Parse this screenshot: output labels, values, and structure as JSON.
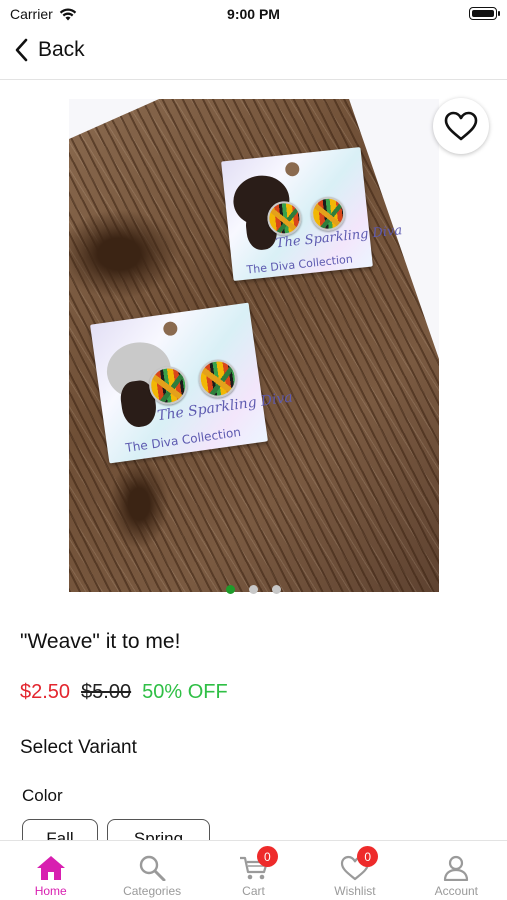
{
  "status_bar": {
    "carrier": "Carrier",
    "time": "9:00 PM"
  },
  "nav": {
    "back_label": "Back"
  },
  "product": {
    "image_card_script": "The Sparkling Diva",
    "image_card_collection": "The Diva Collection",
    "title": "\"Weave\" it to me!",
    "sale_price": "$2.50",
    "original_price": "$5.00",
    "discount": "50% OFF",
    "image_count": 3,
    "active_image": 0
  },
  "variants": {
    "heading": "Select Variant",
    "option_name": "Color",
    "options": [
      "Fall",
      "Spring"
    ]
  },
  "tab_bar": {
    "tabs": [
      {
        "label": "Home",
        "icon": "home-icon",
        "active": true
      },
      {
        "label": "Categories",
        "icon": "search-icon"
      },
      {
        "label": "Cart",
        "icon": "cart-icon",
        "badge": "0"
      },
      {
        "label": "Wishlist",
        "icon": "heart-icon",
        "badge": "0"
      },
      {
        "label": "Account",
        "icon": "account-icon"
      }
    ]
  },
  "colors": {
    "sale": "#e3262e",
    "discount": "#2fbf45",
    "active_tab": "#d81fb0",
    "badge": "#ee2b2b",
    "active_dot": "#1f9c2b"
  }
}
